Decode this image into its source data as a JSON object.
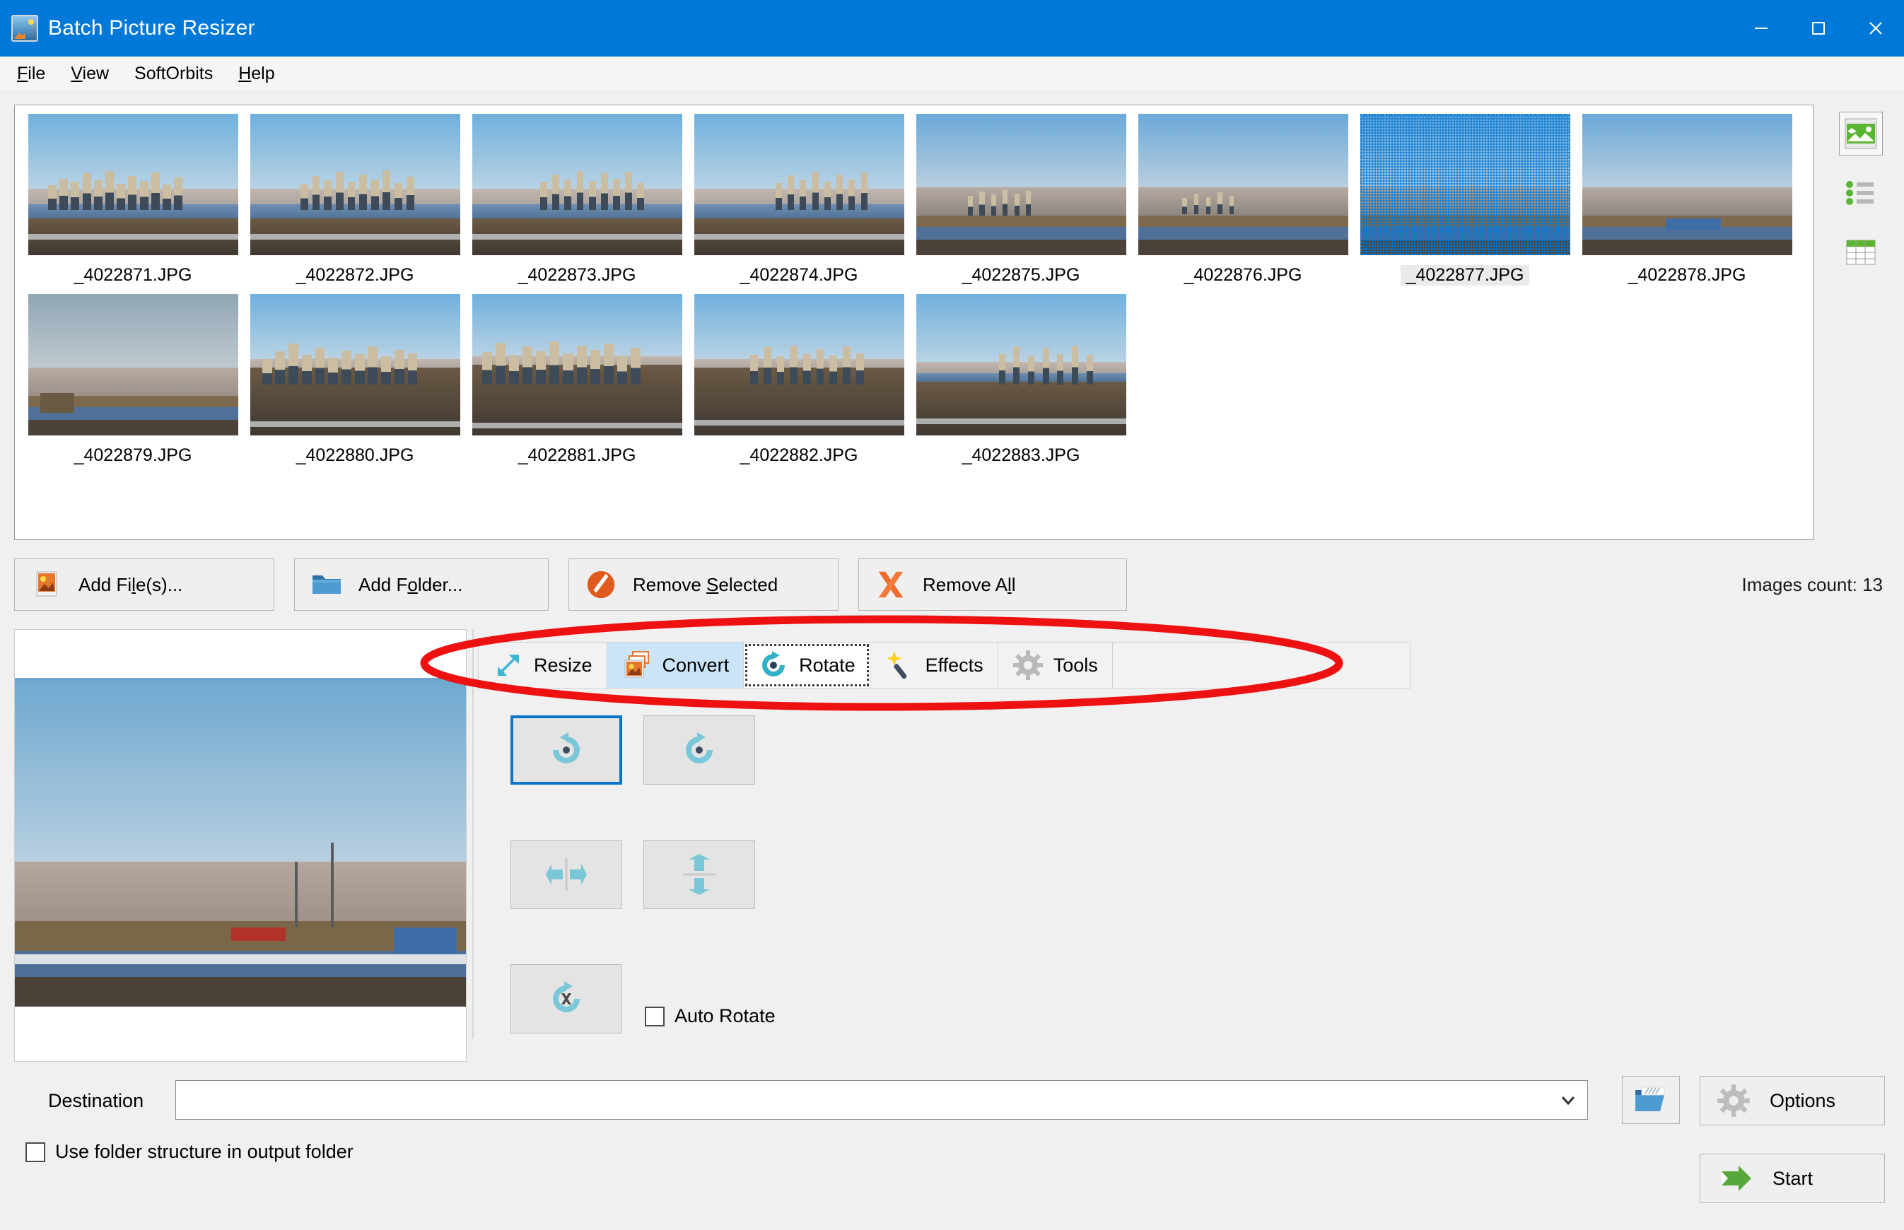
{
  "window": {
    "title": "Batch Picture Resizer",
    "icon": "app-picture-icon",
    "controls": {
      "minimize": "minimize-icon",
      "maximize": "maximize-icon",
      "close": "close-icon"
    }
  },
  "menu": {
    "items": [
      {
        "label": "File",
        "accel": "F",
        "rest": "ile"
      },
      {
        "label": "View",
        "accel": "V",
        "rest": "iew"
      },
      {
        "label": "SoftOrbits",
        "accel": "",
        "rest": "SoftOrbits"
      },
      {
        "label": "Help",
        "accel": "H",
        "rest": "elp"
      }
    ]
  },
  "thumbnails": {
    "row1": [
      {
        "name": "_4022871.JPG",
        "kind": "city",
        "selected": false
      },
      {
        "name": "_4022872.JPG",
        "kind": "city",
        "selected": false
      },
      {
        "name": "_4022873.JPG",
        "kind": "city",
        "selected": false
      },
      {
        "name": "_4022874.JPG",
        "kind": "city",
        "selected": false
      },
      {
        "name": "_4022875.JPG",
        "kind": "city-far",
        "selected": false
      },
      {
        "name": "_4022876.JPG",
        "kind": "city-far",
        "selected": false
      },
      {
        "name": "_4022877.JPG",
        "kind": "landscape",
        "selected": true
      },
      {
        "name": "_4022878.JPG",
        "kind": "landscape",
        "selected": false
      }
    ],
    "row2": [
      {
        "name": "_4022879.JPG",
        "kind": "landscape",
        "selected": false
      },
      {
        "name": "_4022880.JPG",
        "kind": "city",
        "selected": false
      },
      {
        "name": "_4022881.JPG",
        "kind": "city",
        "selected": false
      },
      {
        "name": "_4022882.JPG",
        "kind": "city",
        "selected": false
      },
      {
        "name": "_4022883.JPG",
        "kind": "city",
        "selected": false
      }
    ]
  },
  "view_modes": [
    {
      "name": "thumbnail-view",
      "icon": "picture-icon",
      "active": true
    },
    {
      "name": "list-view",
      "icon": "list-icon",
      "active": false
    },
    {
      "name": "details-view",
      "icon": "table-icon",
      "active": false
    }
  ],
  "actions": {
    "add_files": {
      "pre": "Add Fi",
      "accel": "l",
      "post": "e(s)...",
      "icon": "picture-icon"
    },
    "add_folder": {
      "pre": "Add F",
      "accel": "o",
      "post": "lder...",
      "icon": "folder-icon"
    },
    "remove_selected": {
      "pre": "Remove ",
      "accel": "S",
      "post": "elected",
      "icon": "no-entry-icon"
    },
    "remove_all": {
      "pre": "Remove A",
      "accel": "l",
      "post": "l",
      "icon": "x-cross-icon"
    }
  },
  "images_count_label": "Images count: 13",
  "tabs": [
    {
      "label": "Resize",
      "icon": "resize-arrow-icon",
      "state": "normal"
    },
    {
      "label": "Convert",
      "icon": "convert-images-icon",
      "state": "hover"
    },
    {
      "label": "Rotate",
      "icon": "rotate-circle-icon",
      "state": "active"
    },
    {
      "label": "Effects",
      "icon": "magic-wand-icon",
      "state": "normal"
    },
    {
      "label": "Tools",
      "icon": "gear-icon",
      "state": "normal"
    }
  ],
  "rotate_panel": {
    "buttons": [
      {
        "name": "rotate-left-button",
        "icon": "rotate-ccw-icon",
        "selected": true
      },
      {
        "name": "rotate-right-button",
        "icon": "rotate-cw-icon",
        "selected": false
      },
      {
        "name": "flip-horizontal-button",
        "icon": "flip-horizontal-icon",
        "selected": false
      },
      {
        "name": "flip-vertical-button",
        "icon": "flip-vertical-icon",
        "selected": false
      },
      {
        "name": "no-rotate-button",
        "icon": "rotate-cancel-icon",
        "selected": false
      }
    ],
    "auto_rotate": {
      "label": "Auto Rotate",
      "checked": false
    }
  },
  "destination": {
    "label": "Destination",
    "value": "",
    "placeholder": "",
    "chevron": "chevron-down-icon",
    "browse_icon": "open-folder-icon"
  },
  "use_folder_structure": {
    "label": "Use folder structure in output folder",
    "checked": false
  },
  "footer": {
    "options": {
      "label": "Options",
      "icon": "gear-icon"
    },
    "start": {
      "label": "Start",
      "icon": "green-arrow-icon"
    }
  },
  "annotation": {
    "shape": "ellipse",
    "color": "#ee1111",
    "target": "tab-strip"
  },
  "colors": {
    "titlebar": "#0078d7",
    "accent_blue": "#0a74c8",
    "hover_tab": "#cbe4f7",
    "window_bg": "#f0f0f0",
    "annotation_red": "#ee1111",
    "start_green": "#56a83a"
  }
}
